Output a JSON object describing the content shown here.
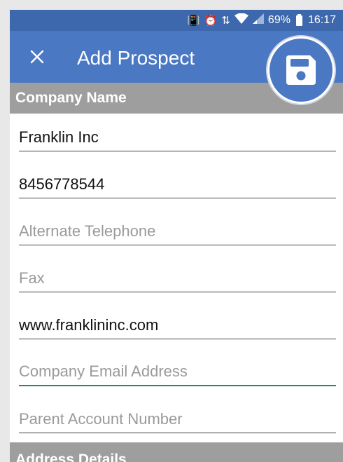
{
  "status_bar": {
    "battery_percent": "69%",
    "time": "16:17",
    "icons": [
      "vibrate-icon",
      "alarm-icon",
      "data-arrows-icon",
      "wifi-icon",
      "signal-icon",
      "battery-icon"
    ]
  },
  "app_bar": {
    "title": "Add Prospect",
    "close_icon": "close-icon",
    "save_icon": "floppy-disk-icon",
    "color": "#4a78c2"
  },
  "sections": {
    "company_name": "Company Name",
    "address_details": "Address Details"
  },
  "fields": {
    "company_name": {
      "value": "Franklin Inc"
    },
    "telephone": {
      "value": "8456778544"
    },
    "alternate_telephone": {
      "placeholder": "Alternate Telephone"
    },
    "fax": {
      "placeholder": "Fax"
    },
    "website": {
      "value": "www.franklininc.com"
    },
    "company_email": {
      "placeholder": "Company Email Address"
    },
    "parent_account": {
      "placeholder": "Parent Account Number"
    }
  },
  "colors": {
    "status_bar": "#3d68ad",
    "section_header": "#9e9e9e",
    "focus_underline": "#1a8c7a"
  }
}
